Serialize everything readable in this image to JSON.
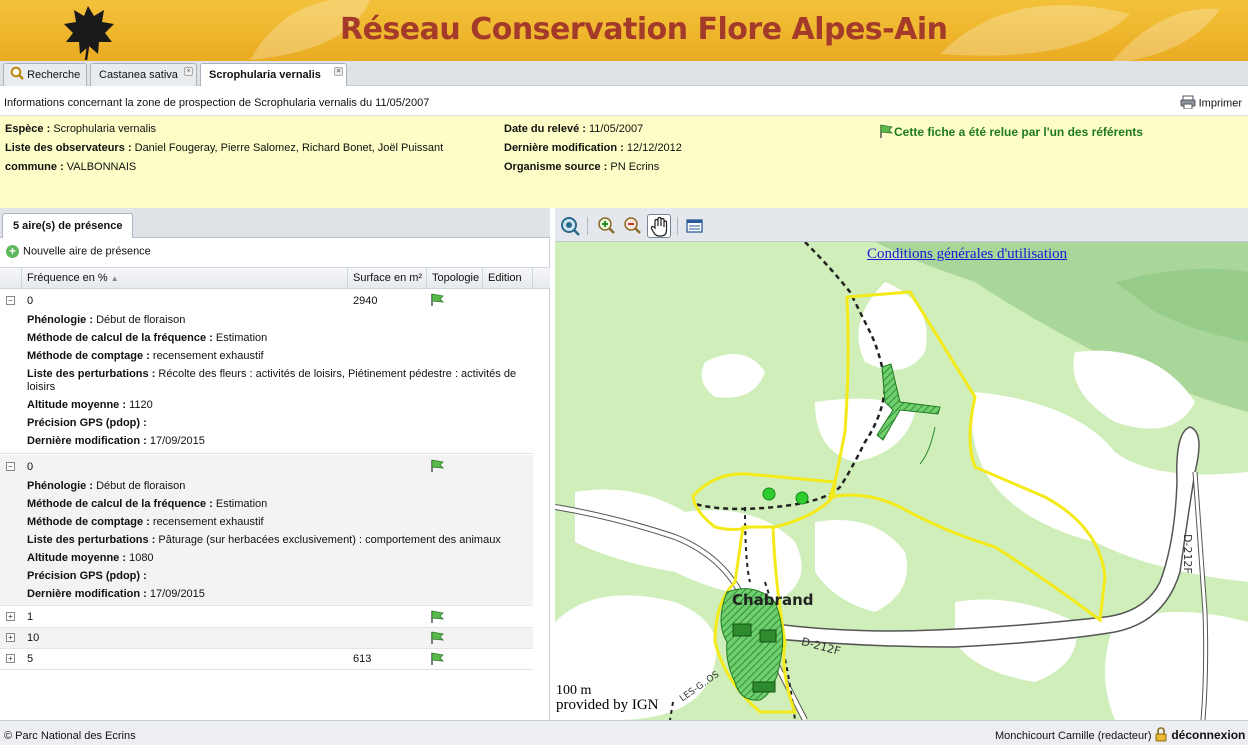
{
  "header": {
    "title": "Réseau Conservation Flore Alpes-Ain"
  },
  "tabs": [
    {
      "label": "Recherche",
      "icon": "search-icon"
    },
    {
      "label": "Castanea sativa"
    },
    {
      "label": "Scrophularia vernalis",
      "active": true
    }
  ],
  "infoline": {
    "text": "Informations concernant la zone de prospection de Scrophularia vernalis du 11/05/2007",
    "print_label": "Imprimer"
  },
  "summary": {
    "espece_label": "Espèce :",
    "espece": "Scrophularia vernalis",
    "observateurs_label": "Liste des observateurs :",
    "observateurs": "Daniel Fougeray, Pierre Salomez, Richard Bonet, Joël Puissant",
    "commune_label": "commune :",
    "commune": "VALBONNAIS",
    "date_label": "Date du relevé :",
    "date": "11/05/2007",
    "modif_label": "Dernière modification :",
    "modif": "12/12/2012",
    "organisme_label": "Organisme source :",
    "organisme": "PN Ecrins",
    "verified": "Cette fiche a été relue par l'un des référents"
  },
  "left": {
    "tab_label": "5 aire(s) de présence",
    "new_area_label": "Nouvelle aire de présence",
    "columns": [
      "Fréquence en %",
      "Surface en m²",
      "Topologie",
      "Edition"
    ],
    "rows": [
      {
        "freq": "0",
        "surface": "2940",
        "expanded": true,
        "details": [
          {
            "label": "Phénologie :",
            "value": "Début de floraison"
          },
          {
            "label": "Méthode de calcul de la fréquence :",
            "value": "Estimation"
          },
          {
            "label": "Méthode de comptage :",
            "value": "recensement exhaustif"
          },
          {
            "label": "Liste des perturbations :",
            "value": "Récolte des fleurs : activités de loisirs, Piétinement pédestre : activités de loisirs"
          },
          {
            "label": "Altitude moyenne :",
            "value": "1120"
          },
          {
            "label": "Précision GPS (pdop) :",
            "value": ""
          },
          {
            "label": "Dernière modification :",
            "value": "17/09/2015"
          }
        ]
      },
      {
        "freq": "0",
        "surface": "",
        "expanded": true,
        "details": [
          {
            "label": "Phénologie :",
            "value": "Début de floraison"
          },
          {
            "label": "Méthode de calcul de la fréquence :",
            "value": "Estimation"
          },
          {
            "label": "Méthode de comptage :",
            "value": "recensement exhaustif"
          },
          {
            "label": "Liste des perturbations :",
            "value": "Pâturage (sur herbacées exclusivement) : comportement des animaux"
          },
          {
            "label": "Altitude moyenne :",
            "value": "1080"
          },
          {
            "label": "Précision GPS (pdop) :",
            "value": ""
          },
          {
            "label": "Dernière modification :",
            "value": "17/09/2015"
          }
        ]
      },
      {
        "freq": "1",
        "surface": "",
        "expanded": false
      },
      {
        "freq": "10",
        "surface": "",
        "expanded": false
      },
      {
        "freq": "5",
        "surface": "613",
        "expanded": false
      }
    ]
  },
  "map": {
    "cgu_link": "Conditions générales d'utilisation",
    "place_label": "Chabrand",
    "road_label_1": "D-212F",
    "road_label_2": "D-212F",
    "road_label_3": "LES-G..OS",
    "scale": "100 m",
    "provider": "provided by IGN"
  },
  "footer": {
    "copyright": "© Parc National des Ecrins",
    "user": "Monchicourt Camille (redacteur)",
    "logout": "déconnexion"
  }
}
